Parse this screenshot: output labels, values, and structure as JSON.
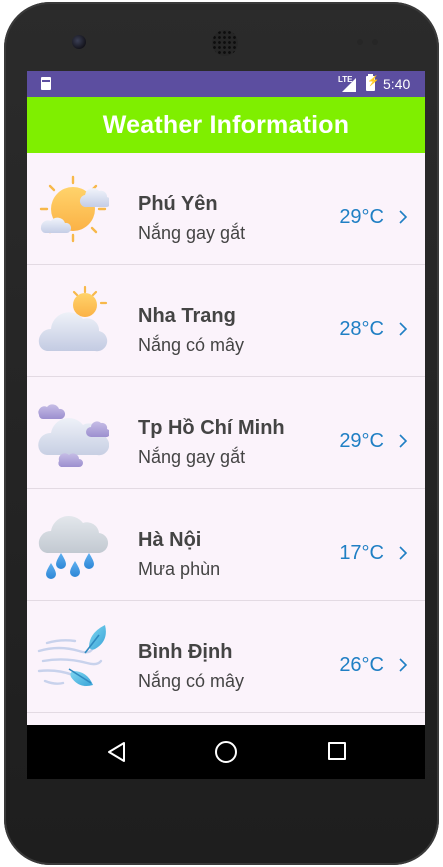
{
  "status_bar": {
    "network_label": "LTE",
    "battery_glyph": "⚡",
    "time": "5:40",
    "color": "#5c4ea0"
  },
  "app_bar": {
    "title": "Weather Information",
    "color": "#7fef00"
  },
  "weather_list": [
    {
      "city": "Phú Yên",
      "description": "Nắng gay gắt",
      "temperature": "29°C",
      "icon": "sun-cloud-icon"
    },
    {
      "city": "Nha Trang",
      "description": "Nắng có mây",
      "temperature": "28°C",
      "icon": "cloud-sun-icon"
    },
    {
      "city": "Tp Hồ Chí Minh",
      "description": "Nắng gay gắt",
      "temperature": "29°C",
      "icon": "clouds-icon"
    },
    {
      "city": "Hà Nội",
      "description": "Mưa phùn",
      "temperature": "17°C",
      "icon": "rain-cloud-icon"
    },
    {
      "city": "Bình Định",
      "description": "Nắng có mây",
      "temperature": "26°C",
      "icon": "wind-leaves-icon"
    }
  ],
  "nav_bar": {
    "back_icon": "back-icon",
    "home_icon": "home-icon",
    "recents_icon": "recents-icon"
  },
  "colors": {
    "temperature": "#1f7fc4",
    "text": "#444444",
    "background": "#fbf3fb"
  }
}
